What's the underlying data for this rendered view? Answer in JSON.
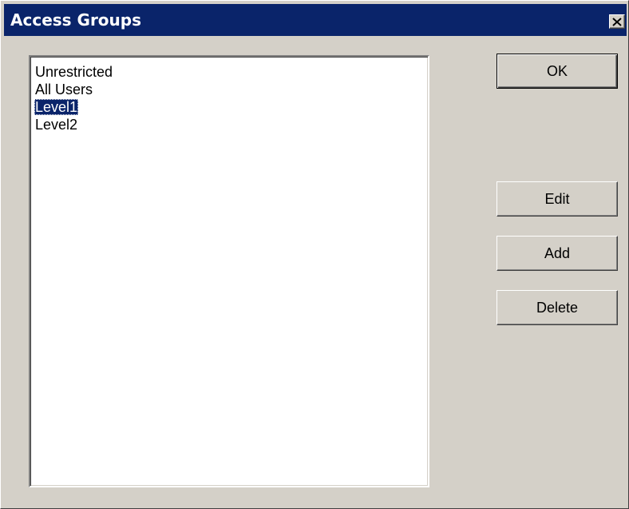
{
  "window": {
    "title": "Access Groups",
    "close_label": "✕"
  },
  "groups_list": {
    "items": [
      {
        "label": "Unrestricted",
        "selected": false
      },
      {
        "label": "All Users",
        "selected": false
      },
      {
        "label": "Level1",
        "selected": true
      },
      {
        "label": "Level2",
        "selected": false
      }
    ]
  },
  "buttons": {
    "ok_label": "OK",
    "edit_label": "Edit",
    "add_label": "Add",
    "delete_label": "Delete"
  },
  "colors": {
    "titlebar": "#0a246a",
    "face": "#d4d0c8",
    "selection": "#0a246a"
  }
}
